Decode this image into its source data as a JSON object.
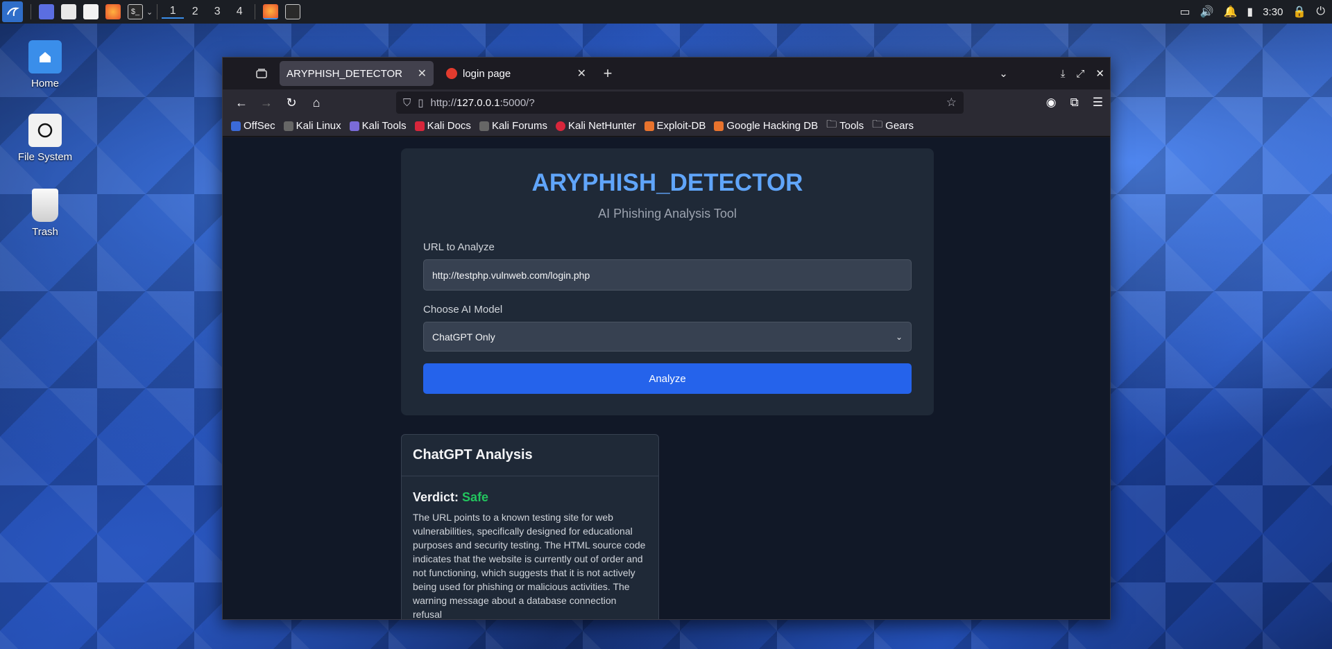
{
  "taskbar": {
    "workspaces": [
      "1",
      "2",
      "3",
      "4"
    ],
    "clock": "3:30"
  },
  "desktop": {
    "icons": [
      {
        "label": "Home"
      },
      {
        "label": "File System"
      },
      {
        "label": "Trash"
      }
    ]
  },
  "browser": {
    "tabs": [
      {
        "title": "ARYPHISH_DETECTOR",
        "active": true
      },
      {
        "title": "login page",
        "active": false
      }
    ],
    "url": {
      "prefix": "http://",
      "host": "127.0.0.1",
      "rest": ":5000/?"
    },
    "bookmarks": [
      "OffSec",
      "Kali Linux",
      "Kali Tools",
      "Kali Docs",
      "Kali Forums",
      "Kali NetHunter",
      "Exploit-DB",
      "Google Hacking DB",
      "Tools",
      "Gears"
    ]
  },
  "app": {
    "title": "ARYPHISH_DETECTOR",
    "subtitle": "AI Phishing Analysis Tool",
    "url_label": "URL to Analyze",
    "url_value": "http://testphp.vulnweb.com/login.php",
    "model_label": "Choose AI Model",
    "model_selected": "ChatGPT Only",
    "analyze_label": "Analyze",
    "result": {
      "heading": "ChatGPT Analysis",
      "verdict_label": "Verdict:",
      "verdict_value": "Safe",
      "text": "The URL points to a known testing site for web vulnerabilities, specifically designed for educational purposes and security testing. The HTML source code indicates that the website is currently out of order and not functioning, which suggests that it is not actively being used for phishing or malicious activities. The warning message about a database connection refusal"
    }
  },
  "colors": {
    "accent": "#60a5fa",
    "button": "#2563eb",
    "safe": "#22c55e"
  }
}
